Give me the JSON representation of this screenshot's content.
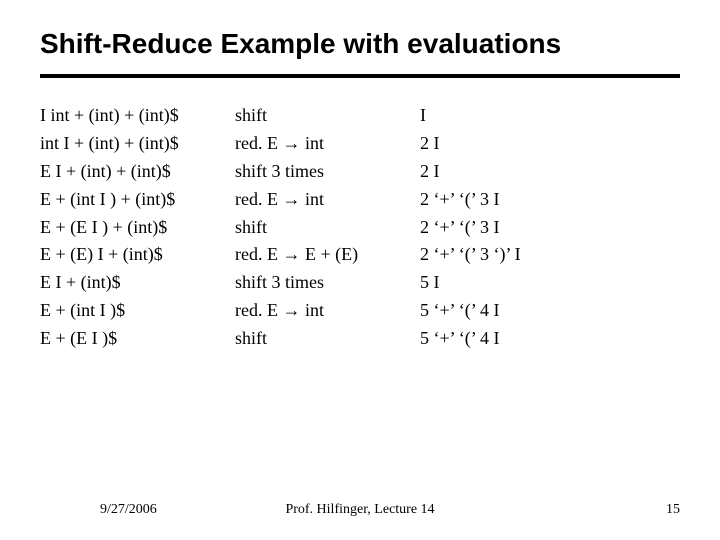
{
  "title": "Shift-Reduce Example with evaluations",
  "col1": [
    "I int + (int) + (int)$",
    "int I + (int) + (int)$",
    "E I + (int) + (int)$",
    "E + (int I ) + (int)$",
    "E + (E I ) + (int)$",
    "E + (E) I + (int)$",
    "E I + (int)$",
    "E + (int I )$",
    "E + (E I )$"
  ],
  "col2": [
    "shift",
    "red. E → int",
    "shift 3 times",
    "red. E → int",
    "shift",
    "red. E → E + (E)",
    "shift 3 times",
    "red. E → int",
    "shift"
  ],
  "col3": [
    "I",
    "2 I",
    "2 I",
    "2 ‘+’ ‘(’ 3 I",
    "2 ‘+’ ‘(’ 3 I",
    "2 ‘+’ ‘(’ 3 ‘)’ I",
    "5 I",
    "5 ‘+’ ‘(’ 4 I",
    "5 ‘+’ ‘(’ 4 I"
  ],
  "footer": {
    "date": "9/27/2006",
    "center": "Prof. Hilfinger, Lecture 14",
    "page": "15"
  }
}
